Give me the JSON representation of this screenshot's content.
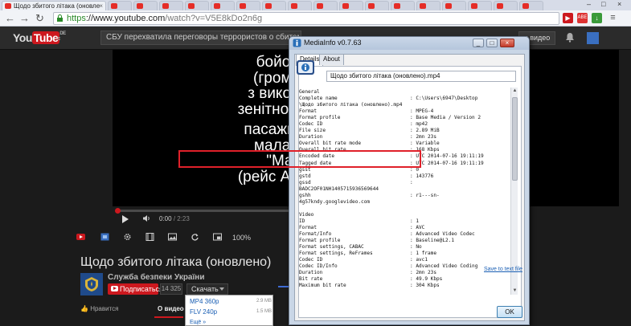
{
  "browser": {
    "active_tab_title": "Щодо збитого літака (оновле",
    "url_scheme": "https",
    "url_host": "://www.youtube.com",
    "url_path": "/watch?v=V5E8kDo2n6g",
    "ext_badge": "ABE"
  },
  "youtube": {
    "logo_you": "You",
    "logo_tube": "Tube",
    "logo_region": "DE",
    "search_text": "СБУ перехватила переговоры террористов о сбитом б",
    "upload_label": "и видео",
    "subtitle_lines": [
      "бойовика",
      "(громадян",
      "з використа",
      "зенітно-ракетн",
      "пасажирськи",
      "малазійсь",
      "\"Malay",
      "(рейс Амстерд"
    ],
    "time_current": "0:00",
    "time_duration": "/ 2:23",
    "zoom_pct": "100%",
    "video_title": "Щодо збитого літака (оновлено)",
    "channel_name": "Служба безпеки України",
    "subscribe_label": "Подписаться",
    "subscriber_count": "14 325",
    "download_label": "Скачать",
    "download_options": [
      {
        "label": "MP4 360p",
        "size": "2.9 MB"
      },
      {
        "label": "FLV 240p",
        "size": "1.5 MB"
      },
      {
        "label": "Ещё »",
        "size": ""
      }
    ],
    "like_label": "Нравится",
    "about_tab": "О видео"
  },
  "mediainfo": {
    "window_title": "MediaInfo v0.7.63",
    "tabs": [
      "Details",
      "About"
    ],
    "file_name": "Щодо збитого літака (оновлено).mp4",
    "rows": [
      {
        "k": "General",
        "v": ""
      },
      {
        "k": "Complete name",
        "v": ": C:\\Users\\6947\\Desktop"
      },
      {
        "k": "\\Щодо збитого літака (оновлено).mp4",
        "v": ""
      },
      {
        "k": "Format",
        "v": ": MPEG-4"
      },
      {
        "k": "Format profile",
        "v": ": Base Media / Version 2"
      },
      {
        "k": "Codec ID",
        "v": ": mp42"
      },
      {
        "k": "File size",
        "v": ": 2.89 MiB"
      },
      {
        "k": "Duration",
        "v": ": 2mn 23s"
      },
      {
        "k": "Overall bit rate mode",
        "v": ": Variable"
      },
      {
        "k": "Overall bit rate",
        "v": ": 168 Kbps"
      },
      {
        "k": "Encoded date",
        "v": ": UTC 2014-07-16 19:11:19"
      },
      {
        "k": "Tagged date",
        "v": ": UTC 2014-07-16 19:11:19"
      },
      {
        "k": "gsst",
        "v": ": 0"
      },
      {
        "k": "gstd",
        "v": ": 143776"
      },
      {
        "k": "gssd",
        "v": ":"
      },
      {
        "k": "BADC2OF01NH1405715936569644",
        "v": ""
      },
      {
        "k": "gshh",
        "v": ": r1---sn-"
      },
      {
        "k": "4g57kndy.googlevideo.com",
        "v": ""
      },
      {
        "k": "",
        "v": ""
      },
      {
        "k": "Video",
        "v": ""
      },
      {
        "k": "ID",
        "v": ": 1"
      },
      {
        "k": "Format",
        "v": ": AVC"
      },
      {
        "k": "Format/Info",
        "v": ": Advanced Video Codec"
      },
      {
        "k": "Format profile",
        "v": ": Baseline@L2.1"
      },
      {
        "k": "Format settings, CABAC",
        "v": ": No"
      },
      {
        "k": "Format settings, ReFrames",
        "v": ": 1 frame"
      },
      {
        "k": "Codec ID",
        "v": ": avc1"
      },
      {
        "k": "Codec ID/Info",
        "v": ": Advanced Video Coding"
      },
      {
        "k": "Duration",
        "v": ": 2mn 23s"
      },
      {
        "k": "Bit rate",
        "v": ": 49.9 Kbps"
      },
      {
        "k": "Maximum bit rate",
        "v": ": 304 Kbps"
      }
    ],
    "save_link": "Save to text file",
    "ok_label": "OK"
  },
  "colors": {
    "youtube_red": "#cc181e",
    "highlight_red": "#e0202a",
    "link_blue": "#1a5fb4"
  }
}
